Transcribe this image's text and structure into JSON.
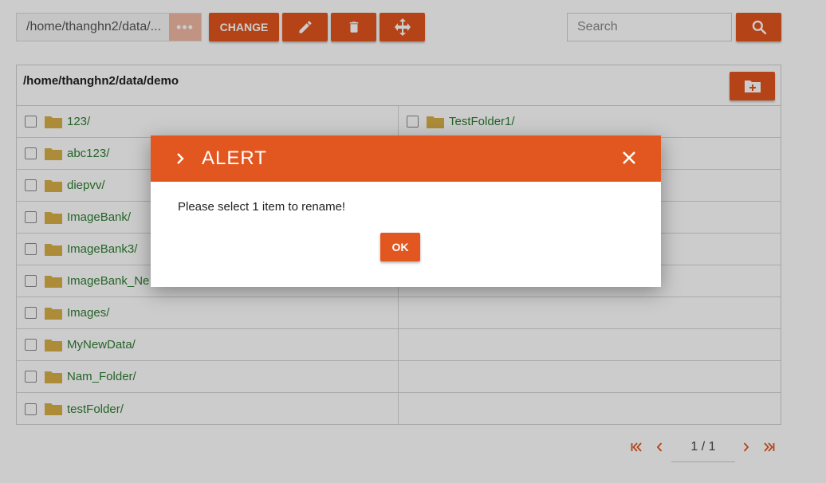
{
  "toolbar": {
    "path": "/home/thanghn2/data/demo",
    "path_display": "/home/thanghn2/data/...",
    "more_label": "•••",
    "change_label": "CHANGE",
    "edit_icon": "pencil-icon",
    "delete_icon": "trash-icon",
    "move_icon": "move-arrows-icon",
    "search_placeholder": "Search",
    "search_icon": "search-icon"
  },
  "browser": {
    "current_path": "/home/thanghn2/data/demo",
    "new_folder_icon": "folder-plus-icon",
    "left_column": [
      "123/",
      "abc123/",
      "diepvv/",
      "ImageBank/",
      "ImageBank3/",
      "ImageBank_Ne",
      "Images/",
      "MyNewData/",
      "Nam_Folder/",
      "testFolder/"
    ],
    "right_column": [
      "TestFolder1/",
      "",
      "",
      "",
      "",
      "",
      "",
      "",
      "",
      ""
    ]
  },
  "pagination": {
    "text": "1 / 1",
    "first_icon": "first-page-icon",
    "prev_icon": "chevron-left-icon",
    "next_icon": "chevron-right-icon",
    "last_icon": "last-page-icon"
  },
  "modal": {
    "title": "ALERT",
    "message": "Please select 1 item to rename!",
    "ok_label": "OK",
    "close_icon": "close-icon"
  },
  "colors": {
    "accent": "#e2561f",
    "folder": "#d9b048",
    "link": "#2e7d32"
  }
}
